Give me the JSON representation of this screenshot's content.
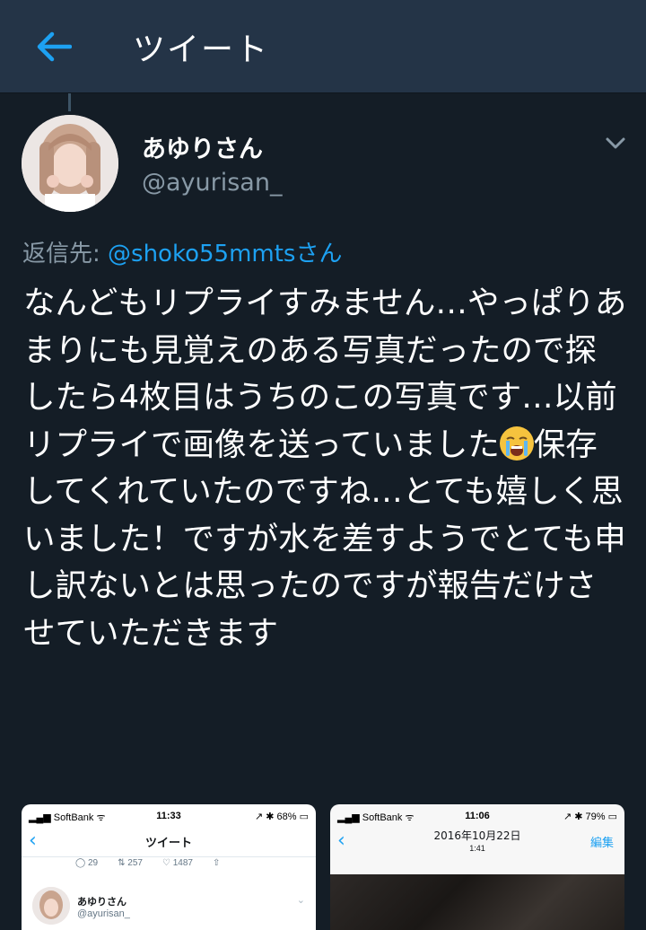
{
  "header": {
    "title": "ツイート"
  },
  "tweet": {
    "display_name": "あゆりさん",
    "handle": "@ayurisan_",
    "reply_prefix": "返信先: ",
    "reply_mention": "@shoko55mmtsさん",
    "text_before_emoji": "なんどもリプライすみません…やっぱりあまりにも見覚えのある写真だったので探したら4枚目はうちのこの写真です…以前リプライで画像を送っていました",
    "emoji_name": "loudly-crying-face-emoji",
    "text_after_emoji": "保存してくれていたのですね…とても嬉しく思いました！ですが水を差すようでとても申し訳ないとは思ったのですが報告だけさせていただきます"
  },
  "media_left": {
    "carrier": "SoftBank",
    "time": "11:33",
    "battery": "68%",
    "nav_title": "ツイート",
    "replies": "29",
    "retweets": "257",
    "likes": "1487",
    "name": "あゆりさん",
    "handle": "@ayurisan_"
  },
  "media_right": {
    "carrier": "SoftBank",
    "time": "11:06",
    "battery": "79%",
    "date": "2016年10月22日",
    "sub_time": "1:41",
    "edit_label": "編集"
  },
  "colors": {
    "background": "#141d26",
    "header_bg": "#243447",
    "accent": "#1da1f2",
    "muted": "#8899a6"
  }
}
